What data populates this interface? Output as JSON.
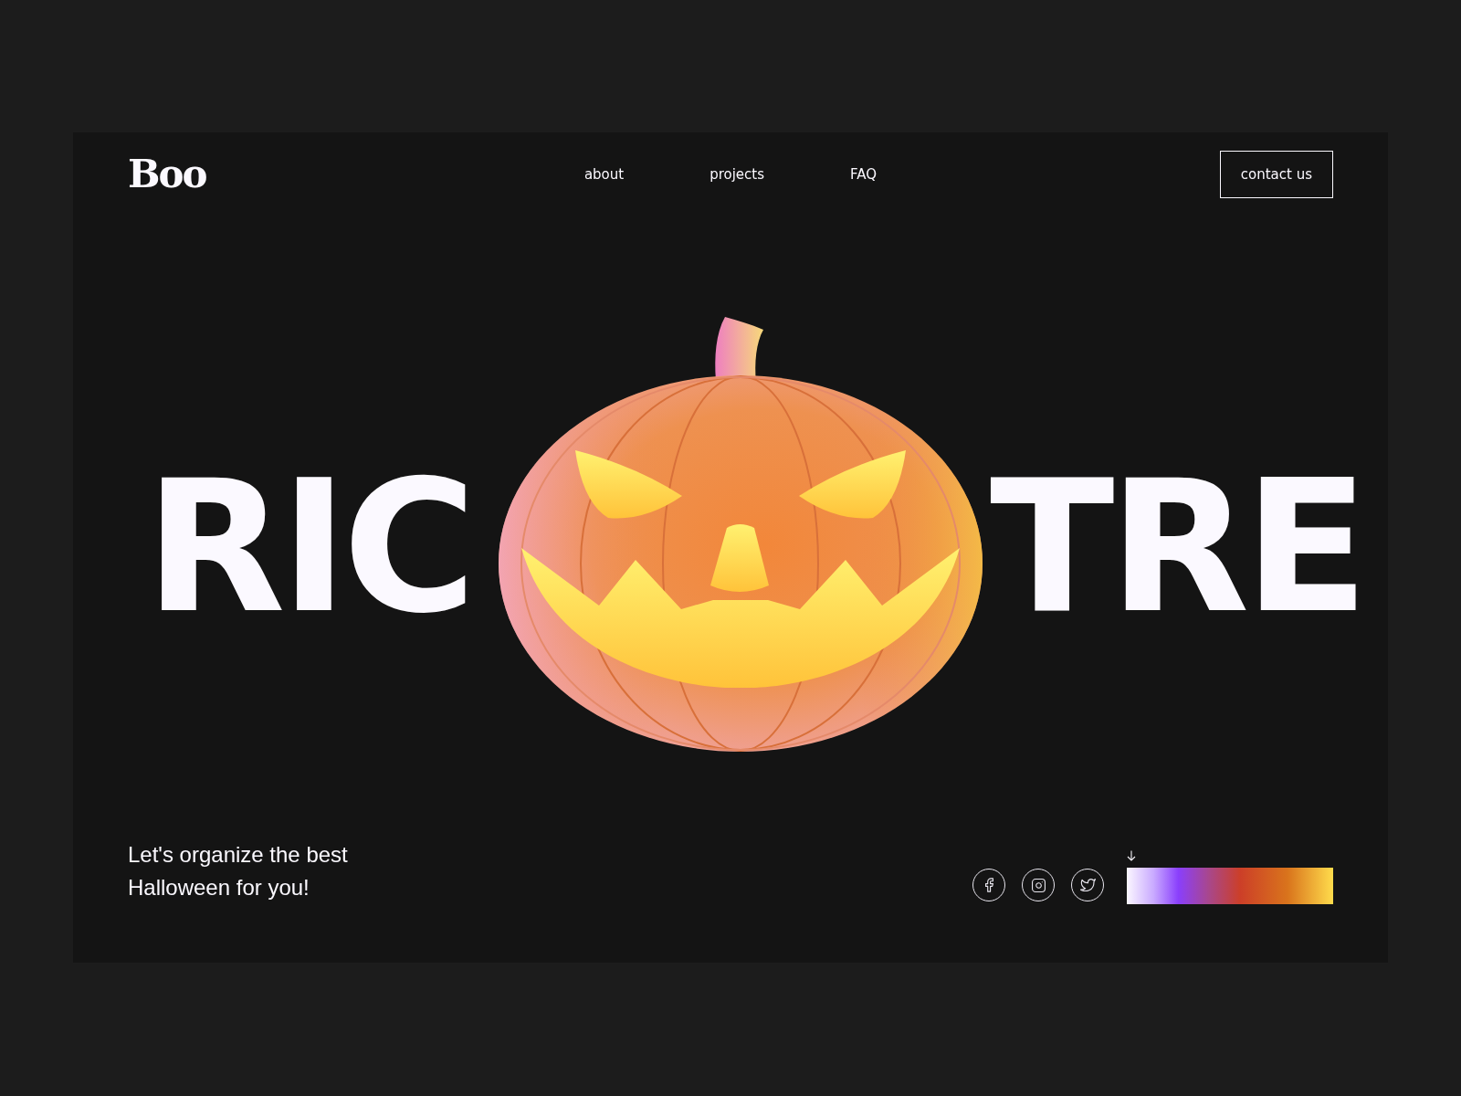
{
  "header": {
    "logo": "Boo",
    "nav": [
      {
        "label": "about"
      },
      {
        "label": "projects"
      },
      {
        "label": "FAQ"
      }
    ],
    "cta": "contact us"
  },
  "hero": {
    "headline_left": "RIC",
    "headline_right": "TRE"
  },
  "footer": {
    "tagline": [
      "Let's organize the best",
      "Halloween for you!"
    ],
    "social": [
      {
        "kind": "facebook"
      },
      {
        "kind": "instagram"
      },
      {
        "kind": "twitter"
      }
    ]
  }
}
